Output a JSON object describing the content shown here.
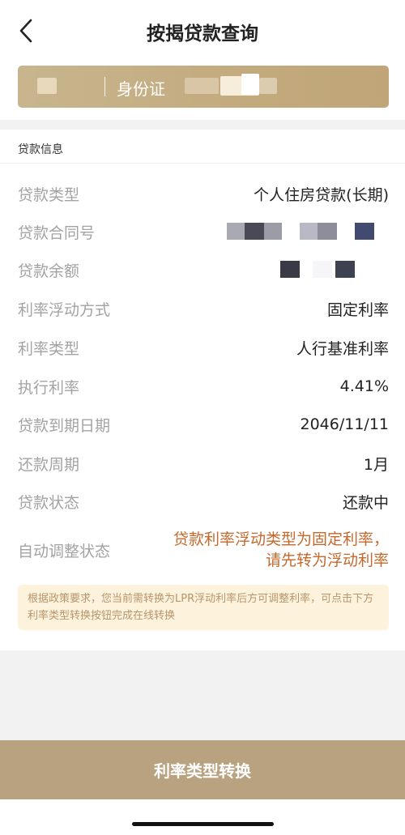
{
  "header": {
    "title": "按揭贷款查询",
    "back_icon": "chevron-left-icon"
  },
  "id_bar": {
    "id_type": "身份证"
  },
  "section": {
    "title": "贷款信息"
  },
  "loan_info": [
    {
      "label": "贷款类型",
      "value": "个人住房贷款(长期)"
    },
    {
      "label": "贷款合同号",
      "value": ""
    },
    {
      "label": "贷款余额",
      "value": ""
    },
    {
      "label": "利率浮动方式",
      "value": "固定利率"
    },
    {
      "label": "利率类型",
      "value": "人行基准利率"
    },
    {
      "label": "执行利率",
      "value": "4.41%"
    },
    {
      "label": "贷款到期日期",
      "value": "2046/11/11"
    },
    {
      "label": "还款周期",
      "value": "1月"
    },
    {
      "label": "贷款状态",
      "value": "还款中"
    }
  ],
  "auto_adjust": {
    "label": "自动调整状态",
    "line1": "贷款利率浮动类型为固定利率，",
    "line2": "请先转为浮动利率"
  },
  "notice": {
    "text": "根据政策要求，您当前需转换为LPR浮动利率后方可调整利率，可点击下方利率类型转换按钮完成在线转换"
  },
  "actions": {
    "convert_label": "利率类型转换"
  },
  "colors": {
    "gold_bar": "#c4ac80",
    "button": "#b9a27f",
    "warn_text": "#c4692c",
    "notice_bg": "#fdf3dd",
    "notice_text": "#b8946a"
  }
}
